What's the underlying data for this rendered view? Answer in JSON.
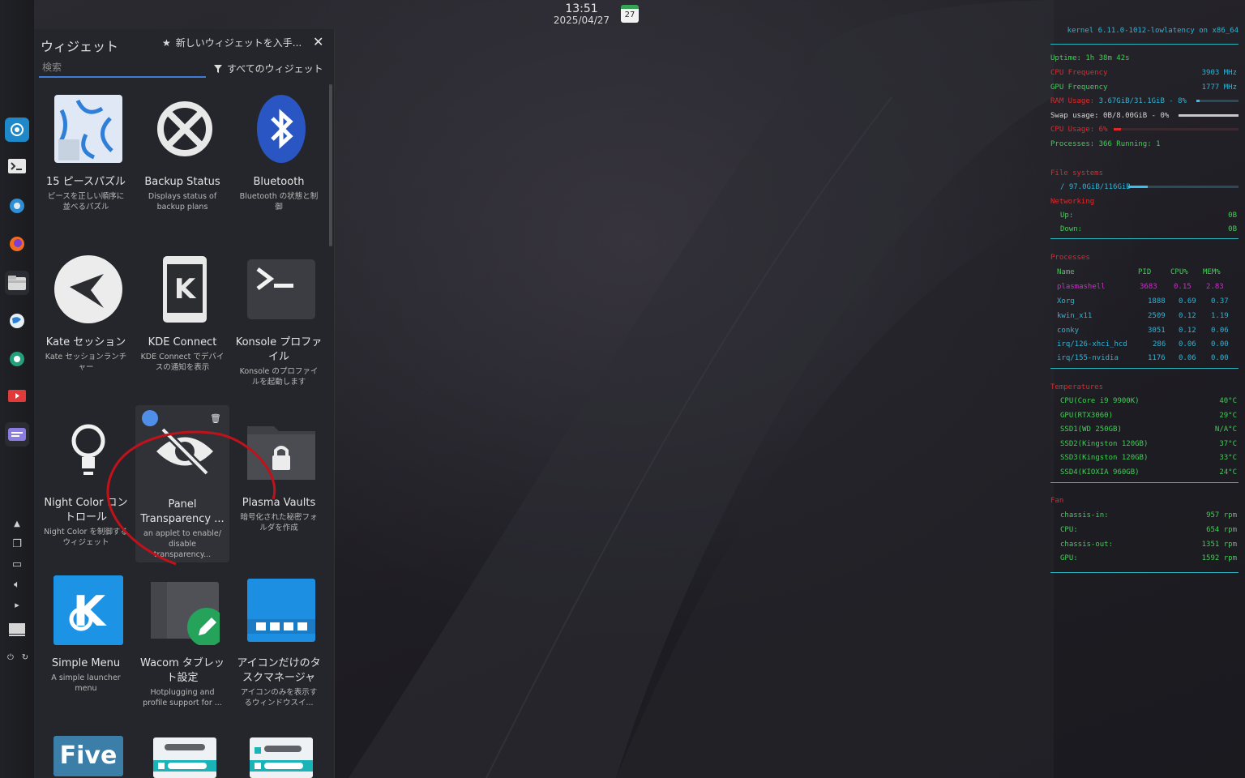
{
  "clock": {
    "time": "13:51",
    "date": "2025/04/27",
    "calendar_day": "27"
  },
  "explorer": {
    "title": "ウィジェット",
    "get_new": "新しいウィジェットを入手...",
    "search_placeholder": "検索",
    "filter": "すべてのウィジェット",
    "widgets": [
      {
        "name": "15 ピースパズル",
        "desc": "ピースを正しい順序に並べるパズル",
        "icon": "puzzle-icon"
      },
      {
        "name": "Backup Status",
        "desc": "Displays status of backup plans",
        "icon": "backup-icon"
      },
      {
        "name": "Bluetooth",
        "desc": "Bluetooth の状態と制御",
        "icon": "bluetooth-icon"
      },
      {
        "name": "Kate セッション",
        "desc": "Kate セッションランチャー",
        "icon": "kate-icon"
      },
      {
        "name": "KDE Connect",
        "desc": "KDE Connect でデバイスの通知を表示",
        "icon": "kdeconnect-icon"
      },
      {
        "name": "Konsole プロファイル",
        "desc": "Konsole のプロファイルを起動します",
        "icon": "terminal-icon"
      },
      {
        "name": "Night Color コントロール",
        "desc": "Night Color を制御するウィジェット",
        "icon": "lightbulb-icon"
      },
      {
        "name": "Panel Transparency ...",
        "desc": "an applet to enable/ disable transparency...",
        "icon": "eye-slash-icon"
      },
      {
        "name": "Plasma Vaults",
        "desc": "暗号化された秘密フォルダを作成",
        "icon": "vault-icon"
      },
      {
        "name": "Simple Menu",
        "desc": "A simple launcher menu",
        "icon": "kde-logo-icon"
      },
      {
        "name": "Wacom タブレット設定",
        "desc": "Hotplugging and profile support for ...",
        "icon": "wacom-icon"
      },
      {
        "name": "アイコンだけのタスクマネージャ",
        "desc": "アイコンのみを表示するウィンドウスイ...",
        "icon": "taskmanager-icon"
      },
      {
        "name": "",
        "desc": "",
        "icon": "five-icon",
        "label": "Five"
      },
      {
        "name": "",
        "desc": "",
        "icon": "panel-icon"
      },
      {
        "name": "",
        "desc": "",
        "icon": "panel-icon"
      }
    ]
  },
  "conky": {
    "kernel": "kernel 6.11.0-1012-lowlatency on x86_64",
    "uptime_label": "Uptime:",
    "uptime": "1h 38m 42s",
    "cpu_freq_label": "CPU Frequency",
    "cpu_freq": "3903 MHz",
    "gpu_freq_label": "GPU Frequency",
    "gpu_freq": "1777 MHz",
    "ram_label": "RAM Usage:",
    "ram": "3.67GiB/31.1GiB - 8%",
    "ram_pct": 8,
    "swap_label": "Swap usage:",
    "swap": "0B/8.00GiB - 0%",
    "swap_pct": 0,
    "cpu_usage_label": "CPU Usage:",
    "cpu_usage": "6%",
    "cpu_pct": 6,
    "processes_label": "Processes:",
    "processes": "366",
    "running_label": "Running:",
    "running": "1",
    "file_header": "File systems",
    "root_fs": "/ 97.0GiB/116GiB",
    "root_pct": 18,
    "network_header": "Networking",
    "up_label": "Up:",
    "up": "0B",
    "down_label": "Down:",
    "down": "0B",
    "proc_header": "Processes",
    "proc_cols": [
      "Name",
      "PID",
      "CPU%",
      "MEM%"
    ],
    "procs": [
      [
        "plasmashell",
        "3683",
        "0.15",
        "2.83"
      ],
      [
        "Xorg",
        "1888",
        "0.69",
        "0.37"
      ],
      [
        "kwin_x11",
        "2509",
        "0.12",
        "1.19"
      ],
      [
        "conky",
        "3051",
        "0.12",
        "0.06"
      ],
      [
        "irq/126-xhci_hcd",
        "286",
        "0.06",
        "0.00"
      ],
      [
        "irq/155-nvidia",
        "1176",
        "0.06",
        "0.00"
      ]
    ],
    "temp_header": "Temperatures",
    "temps": [
      [
        "CPU(Core i9 9900K)",
        "40°C"
      ],
      [
        "GPU(RTX3060)",
        "29°C"
      ],
      [
        "SSD1(WD 250GB)",
        "N/A°C"
      ],
      [
        "SSD2(Kingston 120GB)",
        "37°C"
      ],
      [
        "SSD3(Kingston 120GB)",
        "33°C"
      ],
      [
        "SSD4(KIOXIA 960GB)",
        "24°C"
      ]
    ],
    "fan_header": "Fan",
    "fans": [
      [
        "chassis-in:",
        "957 rpm"
      ],
      [
        "CPU:",
        "654 rpm"
      ],
      [
        "chassis-out:",
        "1351 rpm"
      ],
      [
        "GPU:",
        "1592 rpm"
      ]
    ]
  }
}
